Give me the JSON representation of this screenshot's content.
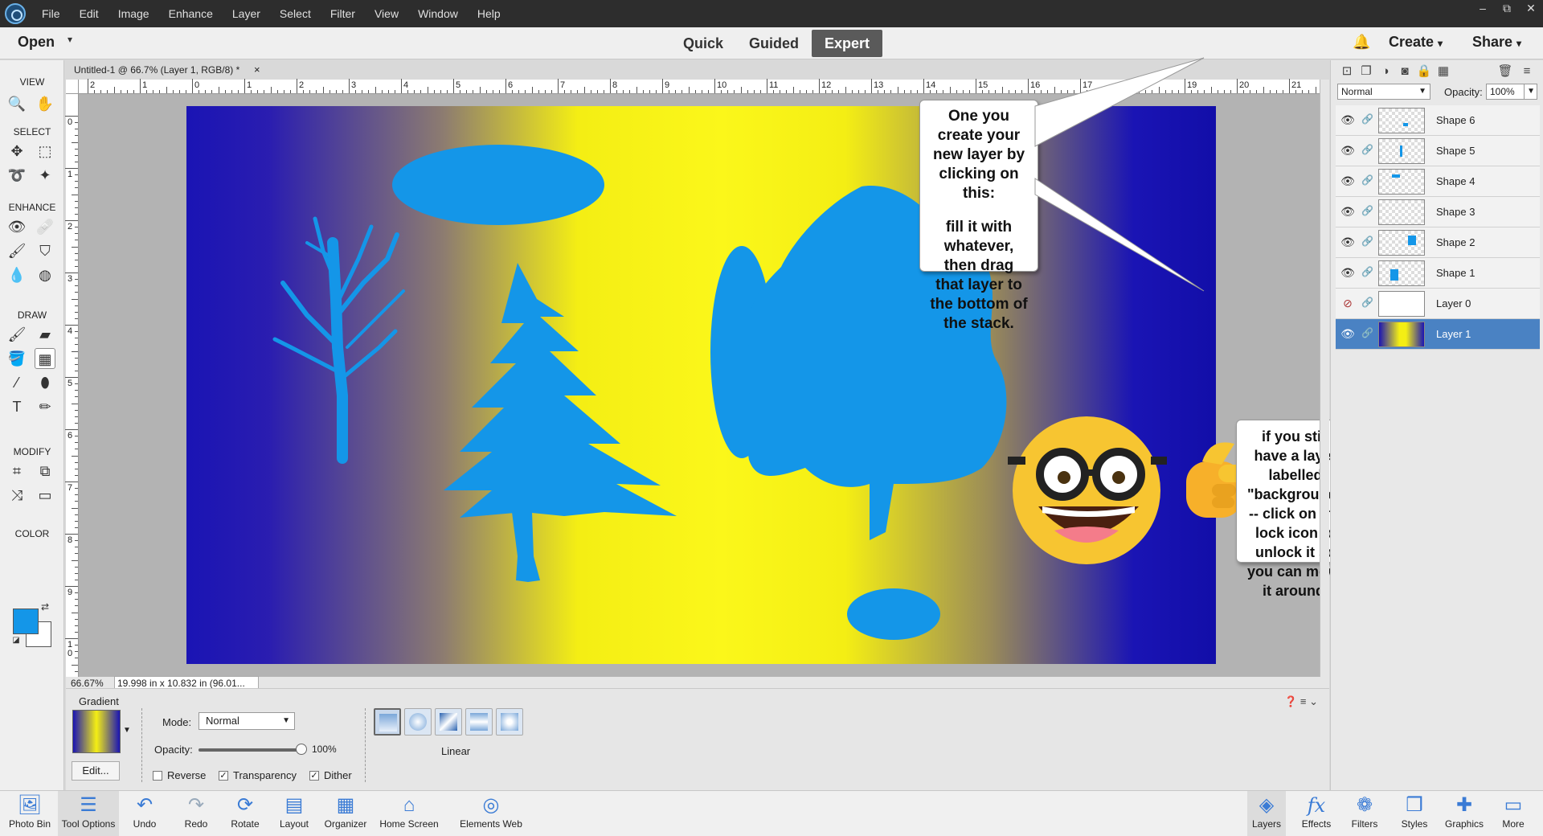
{
  "menubar": {
    "items": [
      "File",
      "Edit",
      "Image",
      "Enhance",
      "Layer",
      "Select",
      "Filter",
      "View",
      "Window",
      "Help"
    ],
    "window_controls": [
      "–",
      "⧉",
      "✕"
    ]
  },
  "modebar": {
    "open_label": "Open",
    "modes": [
      "Quick",
      "Guided",
      "Expert"
    ],
    "active_mode": "Expert",
    "create_label": "Create",
    "share_label": "Share"
  },
  "toolbox": {
    "sections": [
      "VIEW",
      "SELECT",
      "ENHANCE",
      "DRAW",
      "MODIFY",
      "COLOR"
    ],
    "foreground_color": "#1496e8",
    "background_color": "#ffffff"
  },
  "document": {
    "tab_title": "Untitled-1 @ 66.7% (Layer 1, RGB/8) *",
    "close_glyph": "×",
    "zoom": "66.67%",
    "size_info": "19.998 in x 10.832 in (96.01...",
    "h_ruler": [
      "2",
      "1",
      "0",
      "1",
      "2",
      "3",
      "4",
      "5",
      "6",
      "7",
      "8",
      "9",
      "10",
      "11",
      "12",
      "13",
      "14",
      "15",
      "16",
      "17",
      "18",
      "19",
      "20",
      "21"
    ],
    "v_ruler": [
      "0",
      "1",
      "2",
      "3",
      "4",
      "5",
      "6",
      "7",
      "8",
      "9",
      "1\n0"
    ]
  },
  "callouts": {
    "layer_tip_line1": "One you  create your new layer by clicking on this:",
    "layer_tip_line2": "fill it with whatever, then drag that layer to the bottom of the stack.",
    "background_tip": "if you still have a layer labelled \"background\" -- click on the lock icon to unlock it so you can move it around."
  },
  "layers_panel": {
    "blend_mode": "Normal",
    "opacity_label": "Opacity:",
    "opacity_value": "100%",
    "layers": [
      {
        "name": "Shape 6",
        "visible": true
      },
      {
        "name": "Shape 5",
        "visible": true
      },
      {
        "name": "Shape 4",
        "visible": true
      },
      {
        "name": "Shape 3",
        "visible": true
      },
      {
        "name": "Shape 2",
        "visible": true
      },
      {
        "name": "Shape 1",
        "visible": true
      },
      {
        "name": "Layer 0",
        "visible": false
      },
      {
        "name": "Layer 1",
        "visible": true,
        "selected": true
      }
    ]
  },
  "tool_options": {
    "title": "Gradient",
    "edit_label": "Edit...",
    "mode_label": "Mode:",
    "mode_value": "Normal",
    "opacity_label": "Opacity:",
    "opacity_value": "100%",
    "opacity_level": 1.0,
    "reverse_label": "Reverse",
    "reverse_checked": false,
    "transparency_label": "Transparency",
    "transparency_checked": true,
    "dither_label": "Dither",
    "dither_checked": true,
    "gradient_type_label": "Linear"
  },
  "taskbar": {
    "left": [
      "Photo Bin",
      "Tool Options",
      "Undo",
      "Redo",
      "Rotate",
      "Layout",
      "Organizer",
      "Home Screen",
      "Elements Web"
    ],
    "right": [
      "Layers",
      "Effects",
      "Filters",
      "Styles",
      "Graphics",
      "More"
    ]
  },
  "colors": {
    "accent": "#4a82c3",
    "shape_blue": "#1496e8",
    "gradient_blue": "#1a14b4",
    "gradient_yellow": "#f4ee14"
  }
}
